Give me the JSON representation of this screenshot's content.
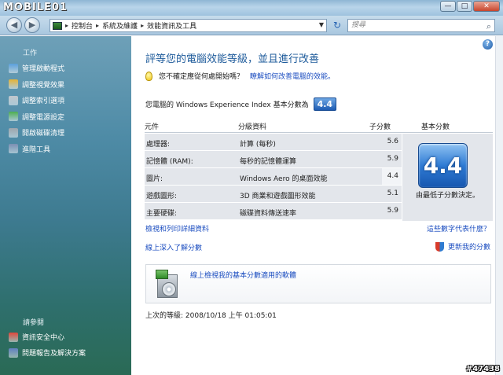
{
  "watermark": {
    "logo": "MOBILE01",
    "tag": "#47438"
  },
  "window": {
    "min": "—",
    "max": "□",
    "close": "✕"
  },
  "toolbar": {
    "back": "◀",
    "forward": "▶",
    "breadcrumb": [
      "控制台",
      "系統及維護",
      "效能資訊及工具"
    ],
    "search_placeholder": "搜尋",
    "refresh": "↻"
  },
  "sidebar": {
    "tasks_header": "工作",
    "tasks": [
      {
        "label": "管理啟動程式",
        "icon": "startup-icon",
        "color": "#5aa0dc"
      },
      {
        "label": "調整視覺效果",
        "icon": "shield-icon",
        "color": "#e5b334"
      },
      {
        "label": "調整索引選項",
        "icon": "index-icon",
        "color": "#c0c6cc"
      },
      {
        "label": "調整電源設定",
        "icon": "power-icon",
        "color": "#4cae4f"
      },
      {
        "label": "開啟磁碟清理",
        "icon": "disk-cleanup-icon",
        "color": "#9ea6ad"
      },
      {
        "label": "進階工具",
        "icon": "advanced-tools-icon",
        "color": "#7b8fb3"
      }
    ],
    "see_also_header": "請參閱",
    "see_also": [
      {
        "label": "資訊安全中心",
        "icon": "security-center-icon",
        "color": "#e0463a"
      },
      {
        "label": "問題報告及解決方案",
        "icon": "problem-reports-icon",
        "color": "#5f7fbf"
      }
    ]
  },
  "main": {
    "title": "評等您的電腦效能等級，並且進行改善",
    "tip_text": "您不確定應從何處開始嗎？",
    "tip_link": "瞭解如何改善電腦的效能。",
    "score_label": "您電腦的 Windows Experience Index 基本分數為",
    "base_score": "4.4",
    "table": {
      "headers": [
        "元件",
        "分級資料",
        "子分數",
        "基本分數"
      ],
      "rows": [
        {
          "component": "處理器:",
          "detail": "計算 (每秒)",
          "subscore": "5.6"
        },
        {
          "component": "記憶體 (RAM):",
          "detail": "每秒的記憶體運算",
          "subscore": "5.9"
        },
        {
          "component": "圖片:",
          "detail": "Windows Aero 的桌面效能",
          "subscore": "4.4"
        },
        {
          "component": "遊戲圖形:",
          "detail": "3D 商業和遊戲圖形效能",
          "subscore": "5.1"
        },
        {
          "component": "主要硬碟:",
          "detail": "磁碟資料傳送速率",
          "subscore": "5.9"
        }
      ],
      "score_caption": "由最低子分數決定。"
    },
    "links": {
      "print_details": "檢視和列印詳細資料",
      "what_mean": "這些數字代表什麼？",
      "learn_online": "線上深入了解分數",
      "update_score": "更新我的分數"
    },
    "software_box": "線上檢視我的基本分數適用的軟體",
    "last_rated": "上次的等級: 2008/10/18 上午 01:05:01"
  }
}
